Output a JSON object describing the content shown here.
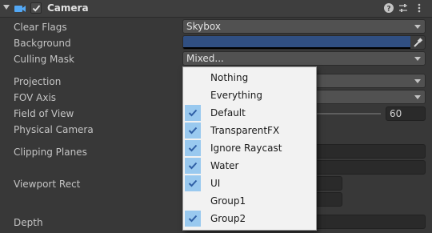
{
  "header": {
    "title": "Camera",
    "enabled": true,
    "icons": [
      "camera-icon",
      "help-icon",
      "preset-icon",
      "kebab-menu-icon"
    ]
  },
  "labels": {
    "clear_flags": "Clear Flags",
    "background": "Background",
    "culling_mask": "Culling Mask",
    "projection": "Projection",
    "fov_axis": "FOV Axis",
    "field_of_view": "Field of View",
    "physical_camera": "Physical Camera",
    "clipping_planes": "Clipping Planes",
    "viewport_rect": "Viewport Rect",
    "depth": "Depth"
  },
  "fields": {
    "clear_flags_value": "Skybox",
    "background_color": "#304f82",
    "culling_mask_value": "Mixed...",
    "field_of_view_value": "60"
  },
  "culling_menu": {
    "items": [
      {
        "label": "Nothing",
        "checked": false
      },
      {
        "label": "Everything",
        "checked": false
      },
      {
        "label": "Default",
        "checked": true
      },
      {
        "label": "TransparentFX",
        "checked": true
      },
      {
        "label": "Ignore Raycast",
        "checked": true
      },
      {
        "label": "Water",
        "checked": true
      },
      {
        "label": "UI",
        "checked": true
      },
      {
        "label": "Group1",
        "checked": false
      },
      {
        "label": "Group2",
        "checked": true
      }
    ]
  },
  "colors": {
    "panel_bg": "#383838",
    "check_highlight": "#99c9ef",
    "check_mark": "#2f5fa5"
  }
}
